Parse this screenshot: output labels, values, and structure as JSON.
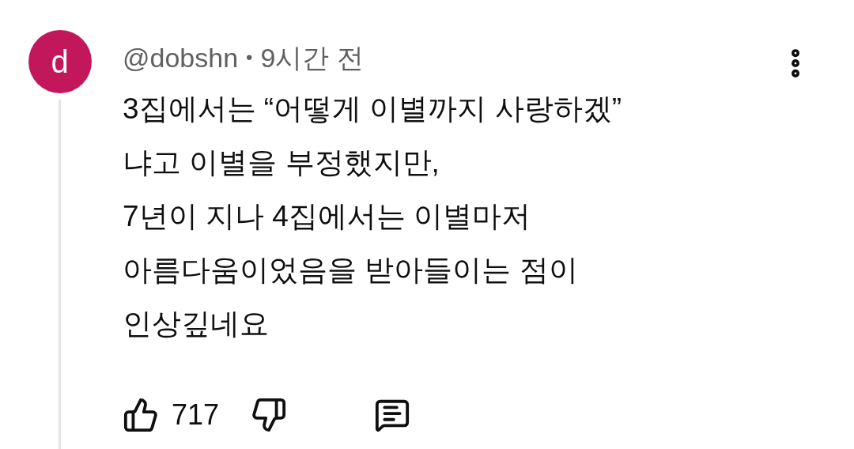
{
  "comment": {
    "avatar": {
      "letter": "d",
      "color": "#c2185b"
    },
    "author": "@dobshn",
    "separator": "•",
    "time": "9시간 전",
    "text": "3집에서는 “어떻게 이별까지 사랑하겠”\n냐고 이별을 부정했지만,\n7년이 지나 4집에서는 이별마저\n아름다움이었음을 받아들이는 점이\n인상깊네요",
    "likes": "717"
  }
}
